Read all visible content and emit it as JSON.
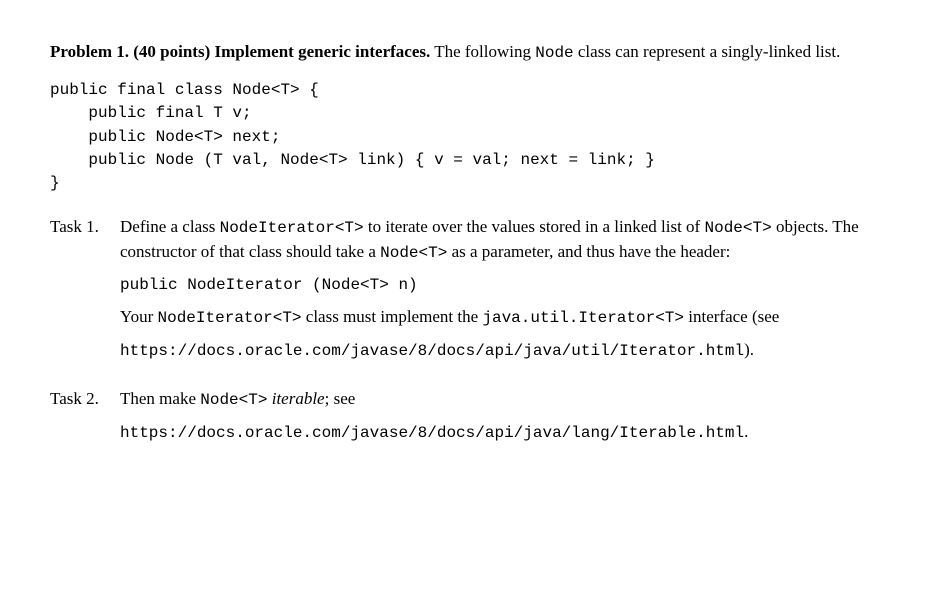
{
  "problem": {
    "label": "Problem 1.",
    "points": "(40 points)",
    "title": "Implement generic interfaces.",
    "intro_pre": "The following ",
    "intro_code": "Node",
    "intro_post": " class can represent a singly-linked list."
  },
  "code": {
    "line1": "public final class Node<T> {",
    "line2": "    public final T v;",
    "line3": "    public Node<T> next;",
    "line4": "    public Node (T val, Node<T> link) { v = val; next = link; }",
    "line5": "}"
  },
  "task1": {
    "label": "Task 1.",
    "p1_a": "Define a class ",
    "p1_code1": "NodeIterator<T>",
    "p1_b": " to iterate over the values stored in a linked list of ",
    "p1_code2": "Node<T>",
    "p1_c": " objects. The constructor of that class should take a ",
    "p1_code3": "Node<T>",
    "p1_d": " as a parameter, and thus have the header:",
    "ctor": "public NodeIterator (Node<T> n)",
    "p2_a": "Your ",
    "p2_code1": "NodeIterator<T>",
    "p2_b": " class must implement the ",
    "p2_code2": "java.util.Iterator<T>",
    "p2_c": " interface (see",
    "url": "https://docs.oracle.com/javase/8/docs/api/java/util/Iterator.html",
    "close": ")."
  },
  "task2": {
    "label": "Task 2.",
    "p1_a": "Then make ",
    "p1_code1": "Node<T>",
    "p1_b": " ",
    "p1_italic": "iterable",
    "p1_c": "; see",
    "url": "https://docs.oracle.com/javase/8/docs/api/java/lang/Iterable.html",
    "close": "."
  }
}
